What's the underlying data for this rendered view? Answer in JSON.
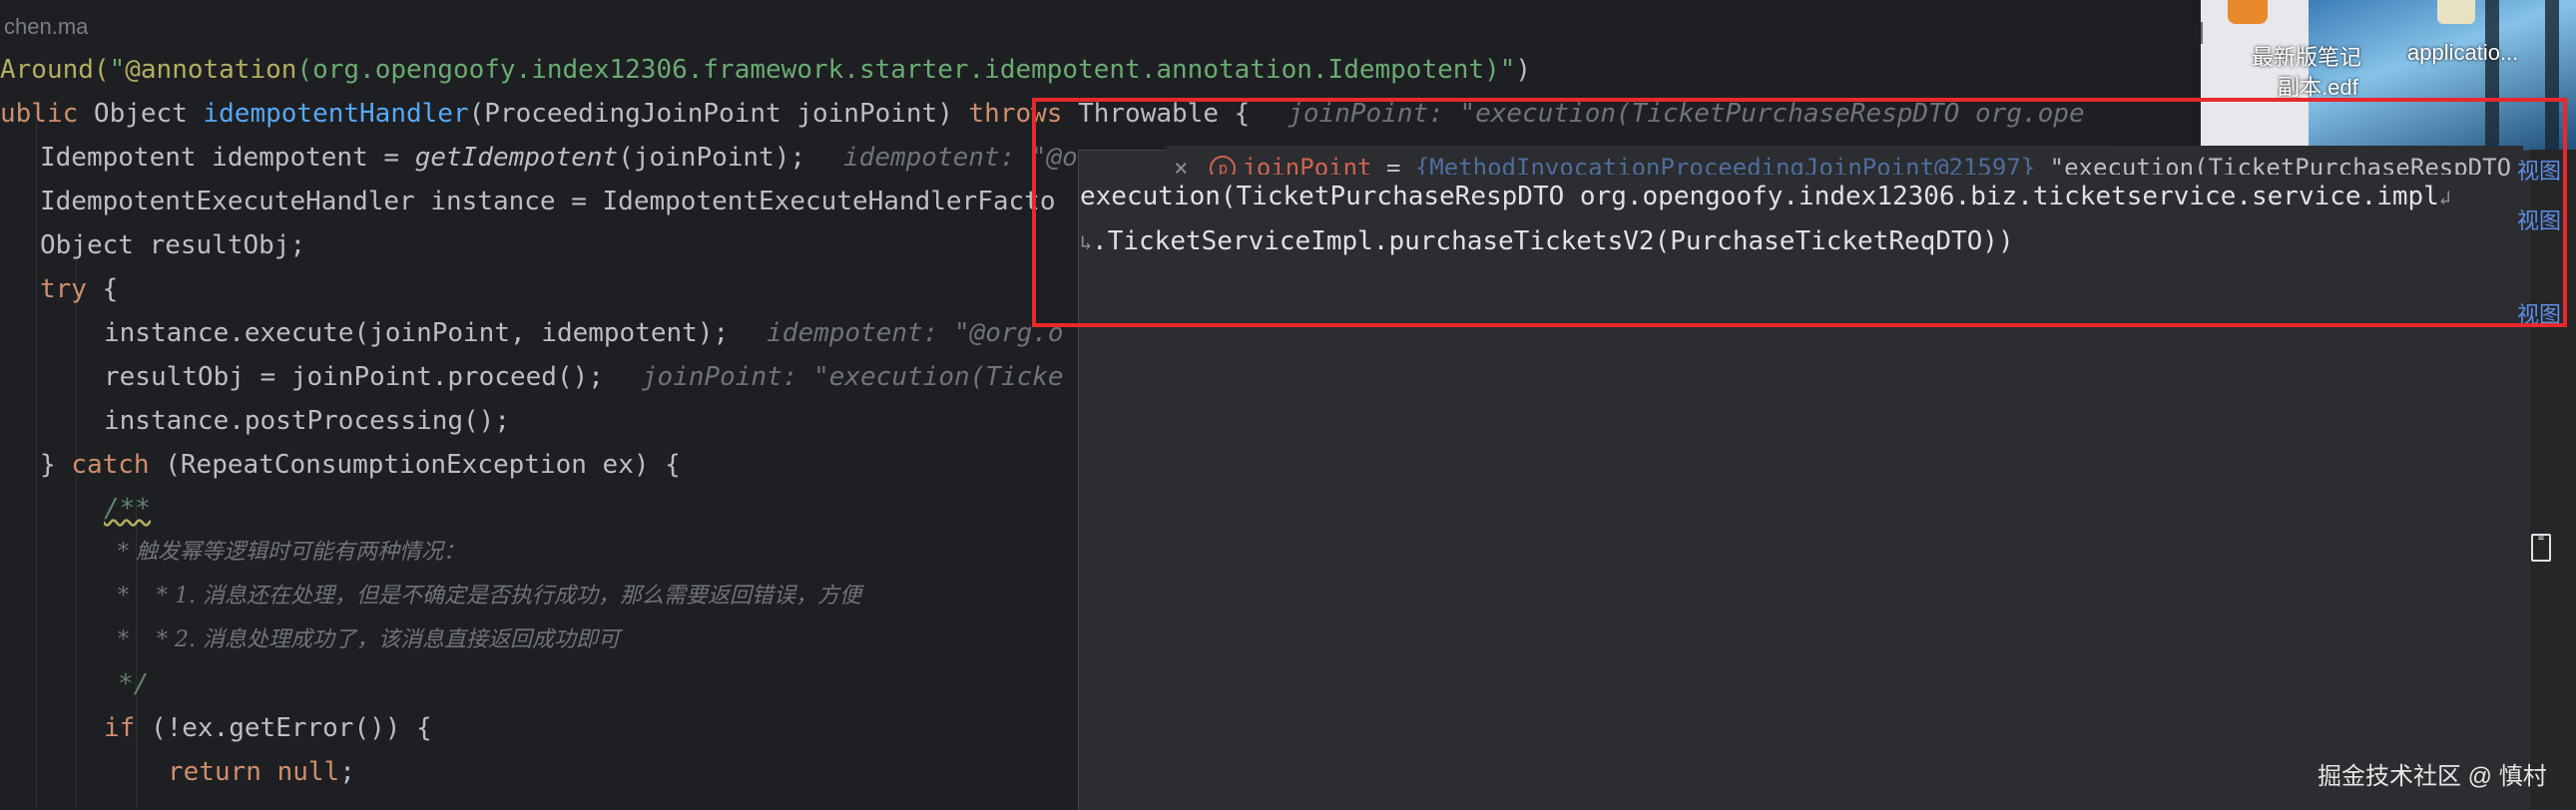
{
  "editor": {
    "author": "chen.ma",
    "code": {
      "l1_around": "Around(",
      "l1_quote_open": "\"",
      "l1_annotation": "@annotation",
      "l1_args": "(org.opengoofy.index12306.framework.starter.idempotent.annotation.Idempotent)",
      "l1_quote_close": "\"",
      "l1_close": ")",
      "l2_public": "ublic ",
      "l2_type": "Object ",
      "l2_method": "idempotentHandler",
      "l2_params": "(ProceedingJoinPoint joinPoint) ",
      "l2_throws": "throws",
      "l2_rest": " Throwable {",
      "l2_hint": "joinPoint: \"execution(TicketPurchaseRespDTO org.ope",
      "l3_code_a": "Idempotent idempotent = ",
      "l3_call": "getIdempotent",
      "l3_code_b": "(joinPoint);",
      "l3_hint": "idempotent: \"@org.",
      "l4_code": "IdempotentExecuteHandler instance = IdempotentExecuteHandlerFacto",
      "l5_code": "Object resultObj;",
      "l6_try": "try",
      "l6_brace": " {",
      "l7_code": "instance.execute(joinPoint, idempotent);",
      "l7_hint": "idempotent: \"@org.o",
      "l8_code": "resultObj = joinPoint.proceed();",
      "l8_hint": "joinPoint: \"execution(Ticke",
      "l9_code": "instance.postProcessing();",
      "l10_brace": "} ",
      "l10_catch": "catch",
      "l10_rest": " (RepeatConsumptionException ex) {",
      "l11_doc": "/**",
      "l12_doc": "* 触发幂等逻辑时可能有两种情况：",
      "l13_doc": "*    * 1. 消息还在处理，但是不确定是否执行成功，那么需要返回错误，方便",
      "l14_doc": "*    * 2. 消息处理成功了，该消息直接返回成功即可",
      "l15_doc": "*/",
      "l16_if": "if",
      "l16_rest": " (!ex.getError()) {",
      "l17_return": "return ",
      "l17_null": "null",
      "l17_semi": ";"
    }
  },
  "popup": {
    "close_glyph": "×",
    "var_badge": "p",
    "var_name": "joinPoint",
    "var_eq": " = ",
    "var_type": "{MethodInvocationProceedingJoinPoint@21597}",
    "var_value": " \"execution(TicketPurchaseRespDTO org.o",
    "value_line1": "execution(TicketPurchaseRespDTO org.opengoofy.index12306.biz.ticketservice.service.impl",
    "wrap_end": "↲",
    "wrap_start": "↳",
    "value_line2": ".TicketServiceImpl.purchaseTicketsV2(PurchaseTicketReqDTO))",
    "side_links": [
      "视图",
      "视图",
      "视图"
    ]
  },
  "desktop": {
    "icon1_label_line1": "最新版笔记",
    "icon1_label_line2": "副本.edf",
    "icon2_label": "applicatio..."
  },
  "watermark": "掘金技术社区 @ 慎村",
  "colors": {
    "highlight_border": "#e8282a",
    "editor_bg": "#1e1f22",
    "keyword": "#cf8e6d",
    "string": "#6aab73",
    "method": "#56a8f5"
  }
}
